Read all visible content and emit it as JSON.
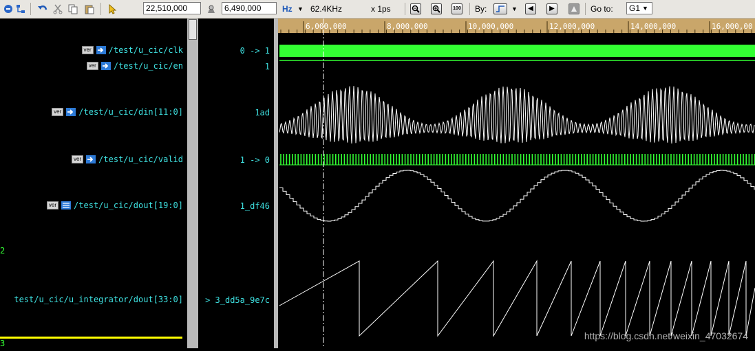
{
  "toolbar": {
    "cursor_time": "22,510,000",
    "marker_time": "6,490,000",
    "freq_unit": "Hz",
    "frequency": "62.4KHz",
    "time_unit": "x 1ps",
    "zoom_icon_label": "100",
    "by_label": "By:",
    "goto_label": "Go to:",
    "goto_value": "G1"
  },
  "timeline": {
    "ticks": [
      "6,000,000",
      "8,000,000",
      "10,000,000",
      "12,000,000",
      "14,000,000",
      "16,000,00"
    ]
  },
  "signals": [
    {
      "name": "/test/u_cic/clk",
      "value": "0 -> 1",
      "badge": "ver"
    },
    {
      "name": "/test/u_cic/en",
      "value": "1",
      "badge": "ver"
    },
    {
      "name": "/test/u_cic/din[11:0]",
      "value": "1ad",
      "badge": "ver"
    },
    {
      "name": "/test/u_cic/valid",
      "value": "1 -> 0",
      "badge": "ver"
    },
    {
      "name": "/test/u_cic/dout[19:0]",
      "value": "1_df46",
      "badge": "ver"
    },
    {
      "name": "test/u_cic/u_integrator/dout[33:0]",
      "value": "> 3_dd5a_9e7c",
      "badge": ""
    }
  ],
  "fragments": {
    "row2": "2",
    "row3": "3"
  },
  "colors": {
    "signal_name": "#3ee0e0",
    "digital": "#33ff33",
    "analog": "#ffffff",
    "cursor": "#ffffff",
    "highlight": "#ffff00"
  },
  "watermark": "https://blog.csdn.net/weixin_47032674"
}
